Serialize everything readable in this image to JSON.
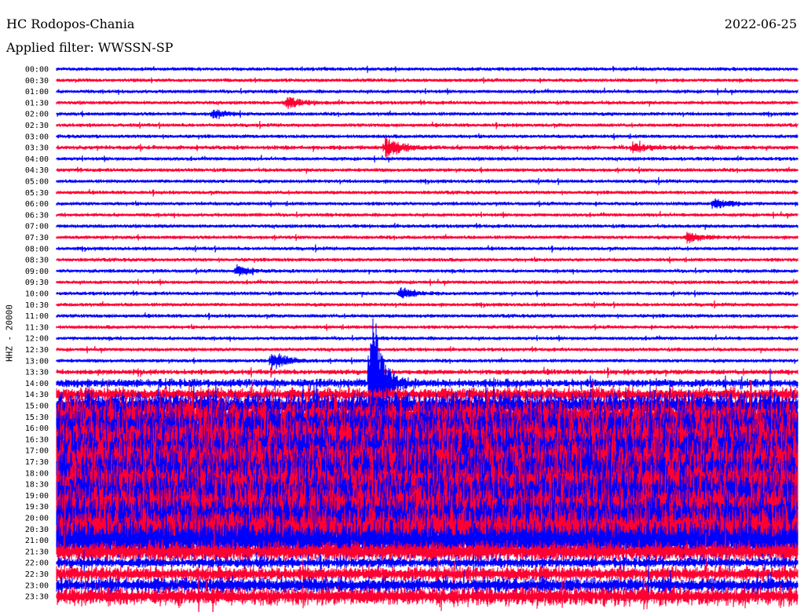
{
  "header": {
    "station": "HC Rodopos-Chania",
    "date": "2022-06-25",
    "filter": "Applied filter: WWSSN-SP"
  },
  "chart_data": {
    "type": "line",
    "title": "HC Rodopos-Chania",
    "ylabel": "HHZ - 20000",
    "minutes_per_line": 30,
    "colors": [
      "#0000ff",
      "#ff0033"
    ],
    "rows": [
      "00:00",
      "00:30",
      "01:00",
      "01:30",
      "02:00",
      "02:30",
      "03:00",
      "03:30",
      "04:00",
      "04:30",
      "05:00",
      "05:30",
      "06:00",
      "06:30",
      "07:00",
      "07:30",
      "08:00",
      "08:30",
      "09:00",
      "09:30",
      "10:00",
      "10:30",
      "11:00",
      "11:30",
      "12:00",
      "12:30",
      "13:00",
      "13:30",
      "14:00",
      "14:30",
      "15:00",
      "15:30",
      "16:00",
      "16:30",
      "17:00",
      "17:30",
      "18:00",
      "18:30",
      "19:00",
      "19:30",
      "20:00",
      "20:30",
      "21:00",
      "21:30",
      "22:00",
      "22:30",
      "23:00",
      "23:30"
    ],
    "noise_level": [
      2,
      2,
      2,
      2,
      2,
      2,
      2,
      2.5,
      2,
      2,
      2,
      2,
      2,
      2,
      2,
      2,
      2,
      2,
      2,
      2,
      2,
      2,
      2,
      2,
      2,
      2,
      2,
      3,
      5,
      8,
      16,
      22,
      28,
      30,
      32,
      32,
      32,
      32,
      32,
      30,
      30,
      28,
      24,
      12,
      6,
      9,
      9,
      11
    ],
    "events": [
      {
        "row": 7,
        "minute": 13.3,
        "amplitude": 14
      },
      {
        "row": 7,
        "minute": 23.3,
        "amplitude": 7
      },
      {
        "row": 3,
        "minute": 9.3,
        "amplitude": 8
      },
      {
        "row": 4,
        "minute": 6.3,
        "amplitude": 6
      },
      {
        "row": 15,
        "minute": 25.5,
        "amplitude": 7
      },
      {
        "row": 18,
        "minute": 7.3,
        "amplitude": 7
      },
      {
        "row": 20,
        "minute": 13.9,
        "amplitude": 8
      },
      {
        "row": 26,
        "minute": 8.7,
        "amplitude": 14
      },
      {
        "row": 28,
        "minute": 12.7,
        "amplitude": 150
      },
      {
        "row": 12,
        "minute": 26.6,
        "amplitude": 8
      }
    ]
  }
}
